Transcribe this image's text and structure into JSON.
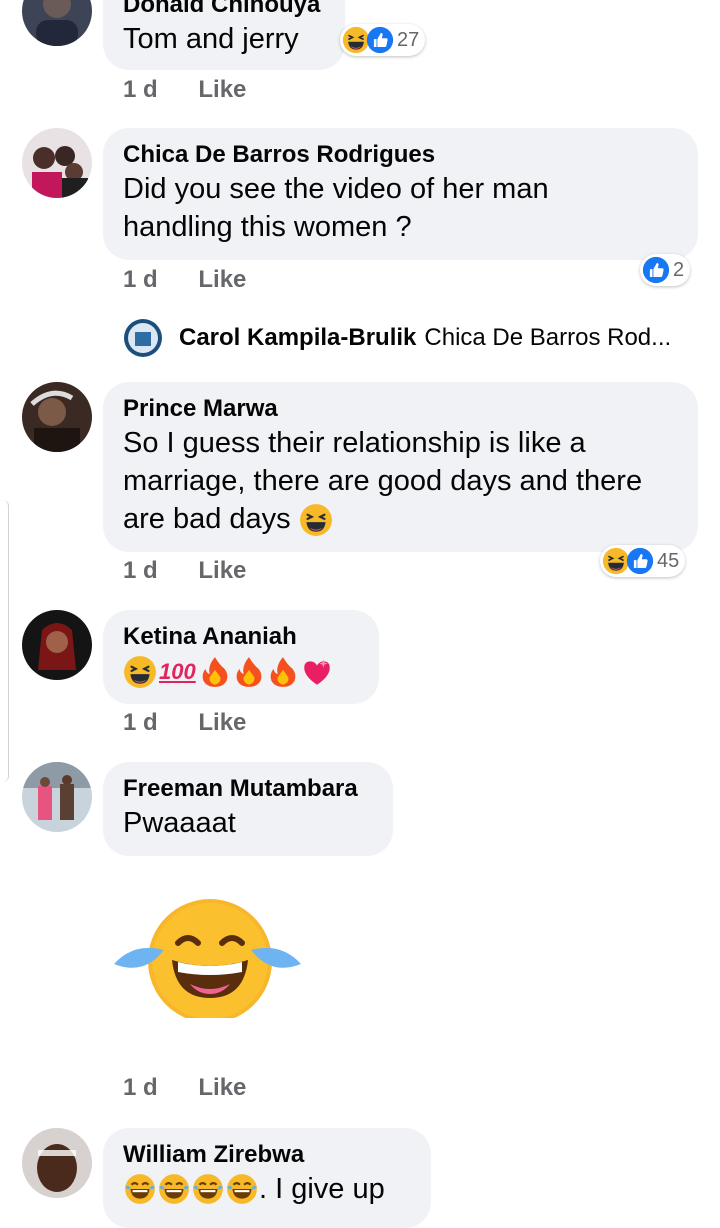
{
  "comments": [
    {
      "author": "Donald Chinouya",
      "text": "Tom and jerry",
      "time": "1 d",
      "like": "Like",
      "reaction_count": "27"
    },
    {
      "author": "Chica De Barros Rodrigues",
      "text_line1": "Did you see the video of her man",
      "text_line2": "handling this women ?",
      "time": "1 d",
      "like": "Like",
      "reaction_count": "2"
    },
    {
      "author": "Prince Marwa",
      "text_line1": "So I guess their relationship is like a",
      "text_line2": "marriage, there are good days and there",
      "text_line3": "are bad days",
      "time": "1 d",
      "like": "Like",
      "reaction_count": "45"
    },
    {
      "author": "Ketina Ananiah",
      "time": "1 d",
      "like": "Like"
    },
    {
      "author": "Freeman Mutambara",
      "text": "Pwaaaat",
      "time": "1 d",
      "like": "Like"
    },
    {
      "author": "William Zirebwa",
      "text": ". I give up"
    }
  ],
  "reply_preview": {
    "author": "Carol Kampila-Brulik",
    "text": "Chica De Barros Rod..."
  },
  "emoji_100": "100",
  "icons": {
    "like": "like-icon",
    "haha": "haha-icon",
    "fire": "fire-icon",
    "heart": "sparkling-heart-icon",
    "hundred": "hundred-points-icon",
    "sticker": "laughing-crying-sticker"
  },
  "colors": {
    "like_blue": "#1877f2",
    "bubble": "#f0f2f5",
    "meta": "#65676b",
    "emoji_yellow": "#f7b928"
  }
}
